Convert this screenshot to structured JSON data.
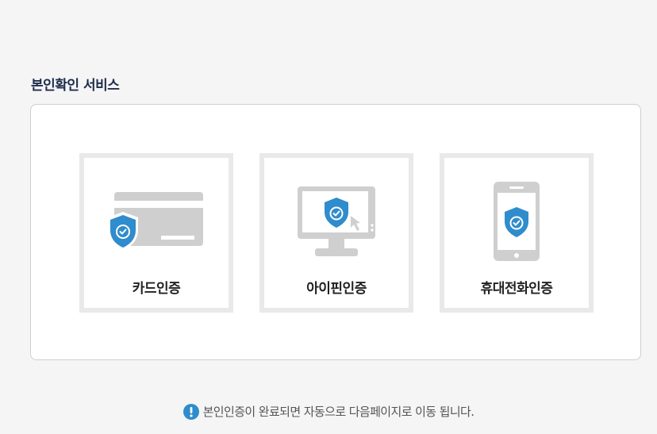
{
  "section": {
    "title": "본인확인 서비스"
  },
  "methods": [
    {
      "label": "카드인증",
      "icon": "credit-card-shield-icon"
    },
    {
      "label": "아이핀인증",
      "icon": "monitor-shield-icon"
    },
    {
      "label": "휴대전화인증",
      "icon": "mobile-phone-shield-icon"
    }
  ],
  "notice": {
    "icon": "exclamation-circle-icon",
    "text": "본인인증이 완료되면 자동으로 다음페이지로 이동 됩니다."
  },
  "colors": {
    "shield": "#2f8ccd",
    "device_gray": "#cfcfcf",
    "title": "#1f2d4d"
  }
}
